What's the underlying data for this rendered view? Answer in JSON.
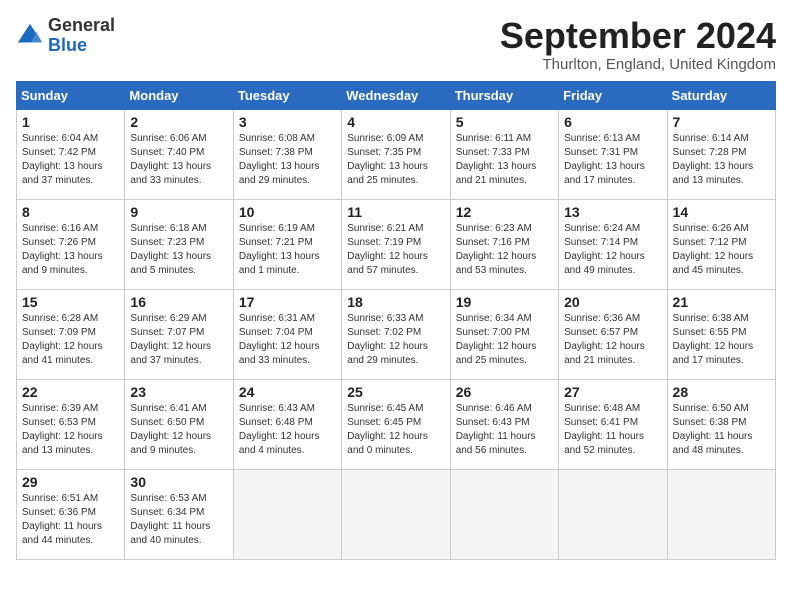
{
  "logo": {
    "general": "General",
    "blue": "Blue"
  },
  "title": "September 2024",
  "location": "Thurlton, England, United Kingdom",
  "days_header": [
    "Sunday",
    "Monday",
    "Tuesday",
    "Wednesday",
    "Thursday",
    "Friday",
    "Saturday"
  ],
  "weeks": [
    [
      {
        "day": "1",
        "sunrise": "Sunrise: 6:04 AM",
        "sunset": "Sunset: 7:42 PM",
        "daylight": "Daylight: 13 hours and 37 minutes."
      },
      {
        "day": "2",
        "sunrise": "Sunrise: 6:06 AM",
        "sunset": "Sunset: 7:40 PM",
        "daylight": "Daylight: 13 hours and 33 minutes."
      },
      {
        "day": "3",
        "sunrise": "Sunrise: 6:08 AM",
        "sunset": "Sunset: 7:38 PM",
        "daylight": "Daylight: 13 hours and 29 minutes."
      },
      {
        "day": "4",
        "sunrise": "Sunrise: 6:09 AM",
        "sunset": "Sunset: 7:35 PM",
        "daylight": "Daylight: 13 hours and 25 minutes."
      },
      {
        "day": "5",
        "sunrise": "Sunrise: 6:11 AM",
        "sunset": "Sunset: 7:33 PM",
        "daylight": "Daylight: 13 hours and 21 minutes."
      },
      {
        "day": "6",
        "sunrise": "Sunrise: 6:13 AM",
        "sunset": "Sunset: 7:31 PM",
        "daylight": "Daylight: 13 hours and 17 minutes."
      },
      {
        "day": "7",
        "sunrise": "Sunrise: 6:14 AM",
        "sunset": "Sunset: 7:28 PM",
        "daylight": "Daylight: 13 hours and 13 minutes."
      }
    ],
    [
      {
        "day": "8",
        "sunrise": "Sunrise: 6:16 AM",
        "sunset": "Sunset: 7:26 PM",
        "daylight": "Daylight: 13 hours and 9 minutes."
      },
      {
        "day": "9",
        "sunrise": "Sunrise: 6:18 AM",
        "sunset": "Sunset: 7:23 PM",
        "daylight": "Daylight: 13 hours and 5 minutes."
      },
      {
        "day": "10",
        "sunrise": "Sunrise: 6:19 AM",
        "sunset": "Sunset: 7:21 PM",
        "daylight": "Daylight: 13 hours and 1 minute."
      },
      {
        "day": "11",
        "sunrise": "Sunrise: 6:21 AM",
        "sunset": "Sunset: 7:19 PM",
        "daylight": "Daylight: 12 hours and 57 minutes."
      },
      {
        "day": "12",
        "sunrise": "Sunrise: 6:23 AM",
        "sunset": "Sunset: 7:16 PM",
        "daylight": "Daylight: 12 hours and 53 minutes."
      },
      {
        "day": "13",
        "sunrise": "Sunrise: 6:24 AM",
        "sunset": "Sunset: 7:14 PM",
        "daylight": "Daylight: 12 hours and 49 minutes."
      },
      {
        "day": "14",
        "sunrise": "Sunrise: 6:26 AM",
        "sunset": "Sunset: 7:12 PM",
        "daylight": "Daylight: 12 hours and 45 minutes."
      }
    ],
    [
      {
        "day": "15",
        "sunrise": "Sunrise: 6:28 AM",
        "sunset": "Sunset: 7:09 PM",
        "daylight": "Daylight: 12 hours and 41 minutes."
      },
      {
        "day": "16",
        "sunrise": "Sunrise: 6:29 AM",
        "sunset": "Sunset: 7:07 PM",
        "daylight": "Daylight: 12 hours and 37 minutes."
      },
      {
        "day": "17",
        "sunrise": "Sunrise: 6:31 AM",
        "sunset": "Sunset: 7:04 PM",
        "daylight": "Daylight: 12 hours and 33 minutes."
      },
      {
        "day": "18",
        "sunrise": "Sunrise: 6:33 AM",
        "sunset": "Sunset: 7:02 PM",
        "daylight": "Daylight: 12 hours and 29 minutes."
      },
      {
        "day": "19",
        "sunrise": "Sunrise: 6:34 AM",
        "sunset": "Sunset: 7:00 PM",
        "daylight": "Daylight: 12 hours and 25 minutes."
      },
      {
        "day": "20",
        "sunrise": "Sunrise: 6:36 AM",
        "sunset": "Sunset: 6:57 PM",
        "daylight": "Daylight: 12 hours and 21 minutes."
      },
      {
        "day": "21",
        "sunrise": "Sunrise: 6:38 AM",
        "sunset": "Sunset: 6:55 PM",
        "daylight": "Daylight: 12 hours and 17 minutes."
      }
    ],
    [
      {
        "day": "22",
        "sunrise": "Sunrise: 6:39 AM",
        "sunset": "Sunset: 6:53 PM",
        "daylight": "Daylight: 12 hours and 13 minutes."
      },
      {
        "day": "23",
        "sunrise": "Sunrise: 6:41 AM",
        "sunset": "Sunset: 6:50 PM",
        "daylight": "Daylight: 12 hours and 9 minutes."
      },
      {
        "day": "24",
        "sunrise": "Sunrise: 6:43 AM",
        "sunset": "Sunset: 6:48 PM",
        "daylight": "Daylight: 12 hours and 4 minutes."
      },
      {
        "day": "25",
        "sunrise": "Sunrise: 6:45 AM",
        "sunset": "Sunset: 6:45 PM",
        "daylight": "Daylight: 12 hours and 0 minutes."
      },
      {
        "day": "26",
        "sunrise": "Sunrise: 6:46 AM",
        "sunset": "Sunset: 6:43 PM",
        "daylight": "Daylight: 11 hours and 56 minutes."
      },
      {
        "day": "27",
        "sunrise": "Sunrise: 6:48 AM",
        "sunset": "Sunset: 6:41 PM",
        "daylight": "Daylight: 11 hours and 52 minutes."
      },
      {
        "day": "28",
        "sunrise": "Sunrise: 6:50 AM",
        "sunset": "Sunset: 6:38 PM",
        "daylight": "Daylight: 11 hours and 48 minutes."
      }
    ],
    [
      {
        "day": "29",
        "sunrise": "Sunrise: 6:51 AM",
        "sunset": "Sunset: 6:36 PM",
        "daylight": "Daylight: 11 hours and 44 minutes."
      },
      {
        "day": "30",
        "sunrise": "Sunrise: 6:53 AM",
        "sunset": "Sunset: 6:34 PM",
        "daylight": "Daylight: 11 hours and 40 minutes."
      },
      null,
      null,
      null,
      null,
      null
    ]
  ]
}
